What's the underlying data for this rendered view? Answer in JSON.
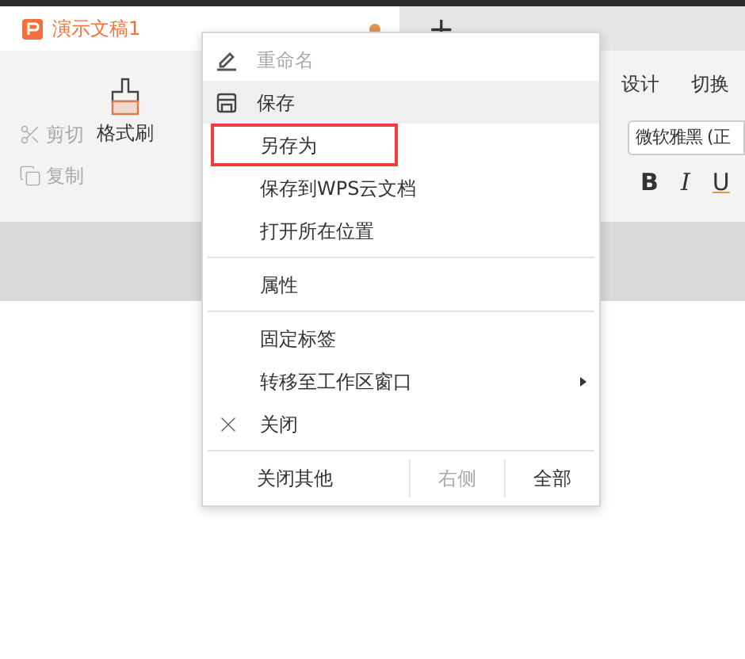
{
  "tabs": [
    {
      "title": "演示文稿1",
      "selected": true,
      "modified": true
    }
  ],
  "new_tab": "+",
  "ribbon": {
    "tabs": [
      {
        "label": "设计"
      },
      {
        "label": "切换"
      }
    ],
    "clipboard": [
      {
        "kind": "cut",
        "label": "剪切",
        "disabled": true
      },
      {
        "kind": "copy",
        "label": "复制",
        "disabled": true
      }
    ],
    "format_painter": "格式刷",
    "font": {
      "value": "微软雅黑 (正"
    },
    "format_buttons": [
      {
        "kind": "bold",
        "label": "B"
      },
      {
        "kind": "italic",
        "label": "I"
      },
      {
        "kind": "underline",
        "label": "U"
      }
    ]
  },
  "context_menu": {
    "items": [
      {
        "kind": "edit",
        "label": "重命名",
        "disabled": true,
        "hovered": false,
        "highlighted": false,
        "submenu": false
      },
      {
        "kind": "save",
        "label": "保存",
        "disabled": false,
        "hovered": true,
        "highlighted": false,
        "submenu": false
      },
      {
        "kind": "item",
        "label": "另存为",
        "disabled": false,
        "hovered": false,
        "highlighted": true,
        "submenu": false
      },
      {
        "kind": "item",
        "label": "保存到WPS云文档",
        "disabled": false,
        "hovered": false,
        "highlighted": false,
        "submenu": false
      },
      {
        "kind": "item",
        "label": "打开所在位置",
        "disabled": false,
        "hovered": false,
        "highlighted": false,
        "submenu": false
      },
      {
        "kind": "separator"
      },
      {
        "kind": "item",
        "label": "属性",
        "disabled": false,
        "hovered": false,
        "highlighted": false,
        "submenu": false
      },
      {
        "kind": "separator"
      },
      {
        "kind": "item",
        "label": "固定标签",
        "disabled": false,
        "hovered": false,
        "highlighted": false,
        "submenu": false
      },
      {
        "kind": "item",
        "label": "转移至工作区窗口",
        "disabled": false,
        "hovered": false,
        "highlighted": false,
        "submenu": true
      },
      {
        "kind": "close",
        "label": "关闭",
        "disabled": false,
        "hovered": false,
        "highlighted": false,
        "submenu": false
      },
      {
        "kind": "separator"
      },
      {
        "kind": "split",
        "parts": [
          {
            "label": "关闭其他",
            "disabled": false
          },
          {
            "label": "右侧",
            "disabled": true
          },
          {
            "label": "全部",
            "disabled": false
          }
        ]
      }
    ]
  }
}
